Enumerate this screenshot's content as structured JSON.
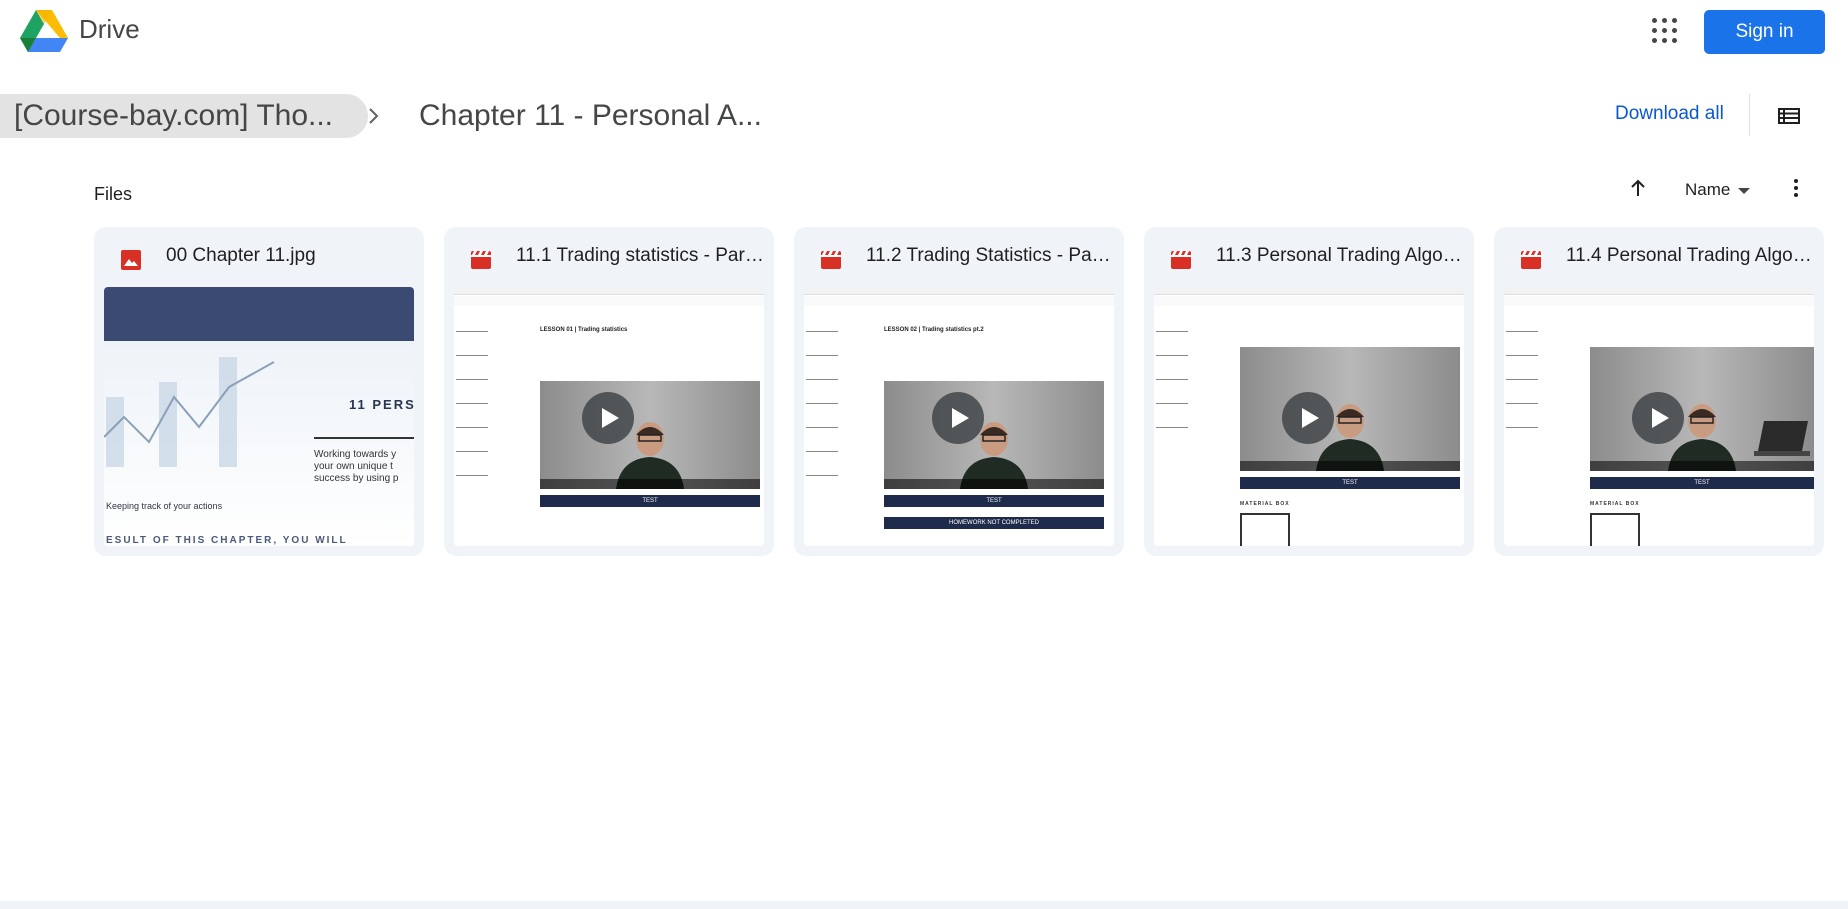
{
  "app": {
    "name": "Drive"
  },
  "header": {
    "signin_label": "Sign in"
  },
  "breadcrumb": {
    "parent": "[Course-bay.com] Tho...",
    "current": "Chapter 11 - Personal A..."
  },
  "toolbar": {
    "download_all": "Download all"
  },
  "files": {
    "section_label": "Files",
    "sort_label": "Name",
    "items": [
      {
        "title": "00 Chapter 11.jpg",
        "type": "image"
      },
      {
        "title": "11.1 Trading statistics - Part ...",
        "type": "video"
      },
      {
        "title": "11.2 Trading Statistics - Part...",
        "type": "video"
      },
      {
        "title": "11.3 Personal Trading Algorit...",
        "type": "video"
      },
      {
        "title": "11.4 Personal Trading Algori...",
        "type": "video"
      }
    ]
  },
  "thumbnail_1": {
    "heading": "11 PERS",
    "text_lines": [
      "Working towards y",
      "your own unique t",
      "success by using p"
    ],
    "caption": "Keeping track of your actions",
    "bottom": "ESULT OF THIS CHAPTER, YOU WILL"
  },
  "thumbnail_2": {
    "lesson": "LESSON 01 | Trading statistics",
    "button": "TEST"
  },
  "thumbnail_3": {
    "lesson": "LESSON 02 | Trading statistics pt.2",
    "button": "TEST",
    "homework": "HOMEWORK NOT COMPLETED"
  },
  "thumbnail_4": {
    "button": "TEST",
    "material": "MATERIAL BOX"
  },
  "thumbnail_5": {
    "button": "TEST",
    "material": "MATERIAL BOX"
  },
  "colors": {
    "accent": "#1a73e8",
    "link": "#0b57d0",
    "card_bg": "#f0f4f9",
    "file_icon_red": "#d93025"
  }
}
